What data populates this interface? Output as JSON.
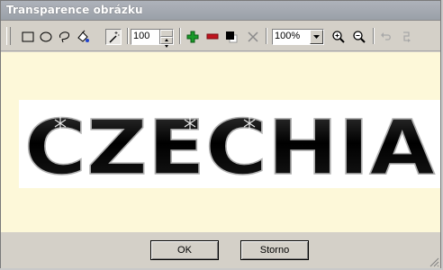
{
  "window": {
    "title": "Transparence obrázku"
  },
  "toolbar": {
    "tools": [
      {
        "name": "rectangle-select-icon"
      },
      {
        "name": "ellipse-select-icon"
      },
      {
        "name": "lasso-select-icon"
      },
      {
        "name": "fill-bucket-icon"
      },
      {
        "name": "magic-wand-icon"
      }
    ],
    "tolerance_value": "100",
    "zoom_value": "100%",
    "colors": {
      "add": "#1a9a2a",
      "remove": "#c0141e"
    }
  },
  "image": {
    "text": "CZECHIA"
  },
  "buttons": {
    "ok_label": "OK",
    "cancel_label": "Storno"
  }
}
